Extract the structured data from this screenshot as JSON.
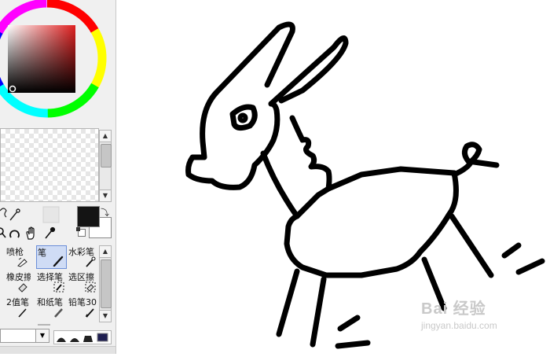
{
  "tools": [
    {
      "label": "喷枪",
      "icon": "airbrush-icon"
    },
    {
      "label": "笔",
      "icon": "pen-icon",
      "selected": true
    },
    {
      "label": "水彩笔",
      "icon": "watercolor-icon"
    },
    {
      "label": "橡皮擦",
      "icon": "eraser-icon"
    },
    {
      "label": "选择笔",
      "icon": "select-pen-icon"
    },
    {
      "label": "选区擦",
      "icon": "select-eraser-icon"
    },
    {
      "label": "2值笔",
      "icon": "binary-pen-icon"
    },
    {
      "label": "和纸笔",
      "icon": "washi-pen-icon"
    },
    {
      "label": "铅笔30",
      "icon": "pencil-icon"
    }
  ],
  "colors": {
    "foreground": "#141414",
    "background": "#ffffff",
    "stroke": "#000000"
  },
  "watermark": {
    "brand": "Bai 经验",
    "url": "jingyan.baidu.com"
  }
}
